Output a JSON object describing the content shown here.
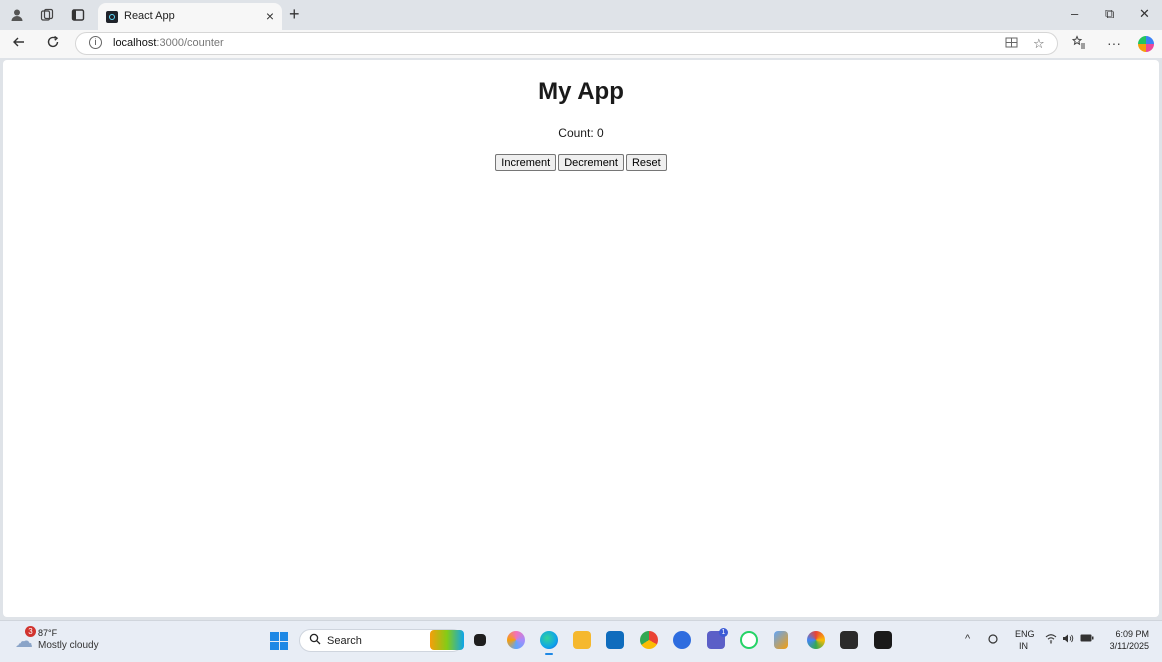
{
  "browser": {
    "tab": {
      "title": "React App",
      "close_glyph": "×"
    },
    "new_tab_glyph": "+",
    "window_controls": {
      "minimize": "–",
      "restore": "⧉",
      "close": "✕"
    },
    "address": {
      "host": "localhost",
      "path": ":3000/counter"
    },
    "icons": [
      "profile-icon",
      "workspaces-icon",
      "tab-actions-icon",
      "back-icon",
      "refresh-icon",
      "info-icon",
      "split-screen-icon",
      "favorite-star-icon",
      "favorites-icon",
      "more-icon",
      "copilot-icon"
    ]
  },
  "page": {
    "title": "My App",
    "count_label": "Count: ",
    "count_value": "0",
    "buttons": {
      "increment": "Increment",
      "decrement": "Decrement",
      "reset": "Reset"
    }
  },
  "taskbar": {
    "weather": {
      "temp": "87°F",
      "desc": "Mostly cloudy",
      "badge": "3"
    },
    "search_placeholder": "Search",
    "badges": {
      "teams": "1"
    },
    "language": {
      "line1": "ENG",
      "line2": "IN"
    },
    "clock": {
      "time": "6:09 PM",
      "date": "3/11/2025"
    },
    "colors": {
      "accent": "#1e88e5",
      "badge_red": "#d1342f"
    }
  }
}
